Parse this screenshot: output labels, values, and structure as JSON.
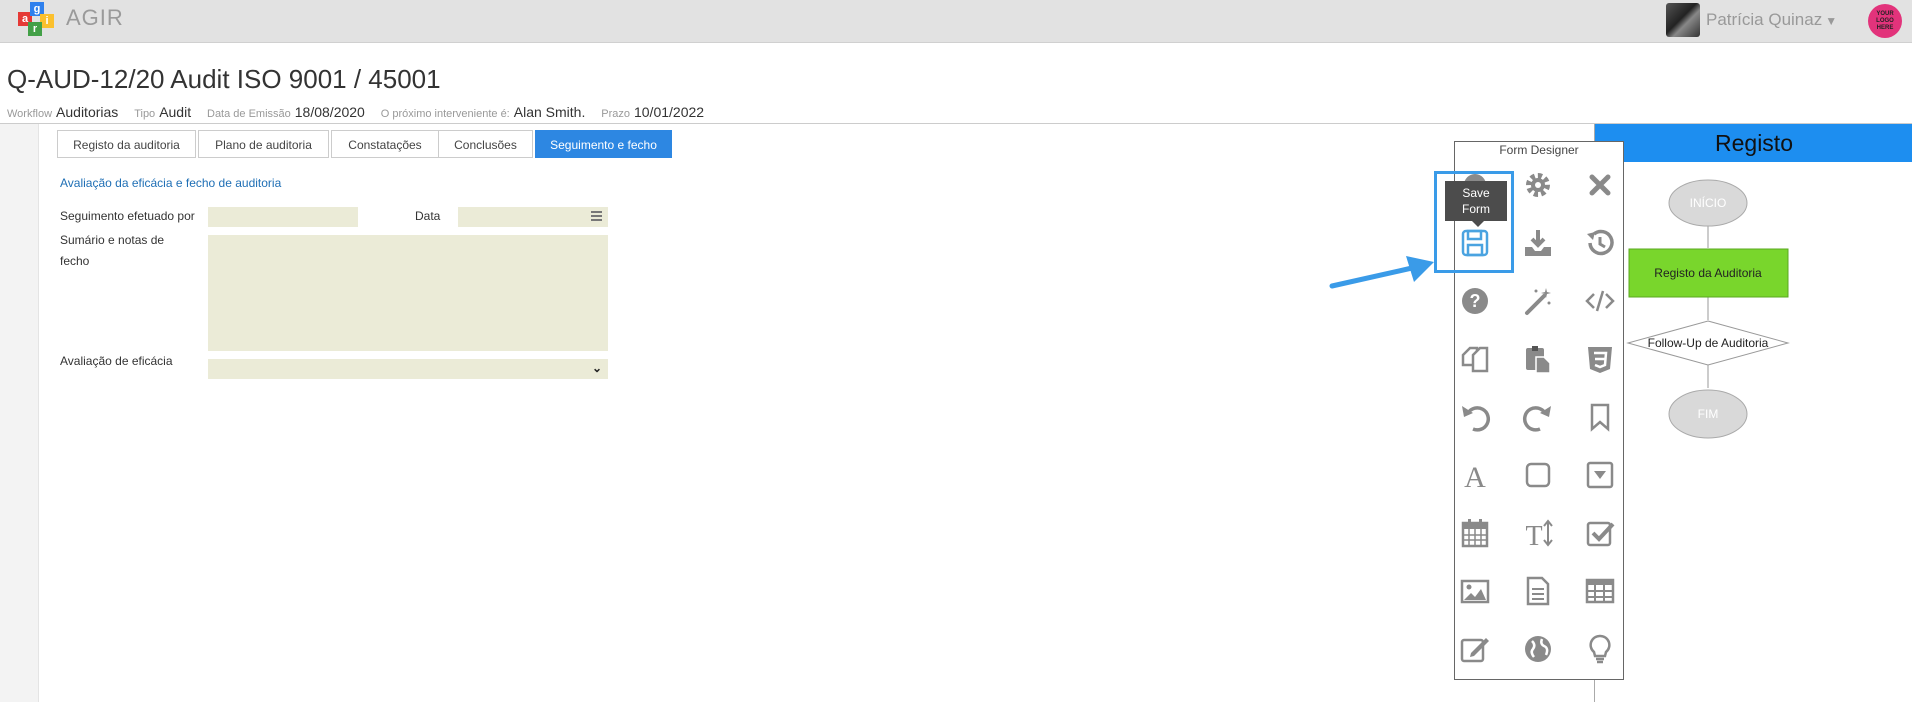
{
  "app": {
    "name": "AGIR",
    "logo_letters": [
      "a",
      "g",
      "i",
      "r"
    ]
  },
  "user": {
    "name": "Patrícia Quinaz",
    "company_logo_text": "YOUR LOGO HERE"
  },
  "header": {
    "title": "Q-AUD-12/20 Audit ISO 9001 / 45001",
    "meta": [
      {
        "label": "Workflow",
        "value": "Auditorias"
      },
      {
        "label": "Tipo",
        "value": "Audit"
      },
      {
        "label": "Data de Emissão",
        "value": "18/08/2020"
      },
      {
        "label": "O próximo interveniente é:",
        "value": "Alan Smith."
      },
      {
        "label": "Prazo",
        "value": "10/01/2022"
      }
    ]
  },
  "tabs": [
    {
      "label": "Registo da auditoria",
      "active": false
    },
    {
      "label": "Plano de auditoria",
      "active": false
    },
    {
      "label": "Constatações",
      "active": false
    },
    {
      "label": "Conclusões",
      "active": false
    },
    {
      "label": "Seguimento e fecho",
      "active": true
    }
  ],
  "form": {
    "section_title": "Avaliação da eficácia e fecho de auditoria",
    "seguimento_label": "Seguimento efetuado por",
    "seguimento_value": "",
    "data_label": "Data",
    "data_value": "",
    "sumario_label_line1": "Sumário e notas de",
    "sumario_label_line2": "fecho",
    "sumario_value": "",
    "avaliacao_label": "Avaliação de eficácia",
    "avaliacao_value": ""
  },
  "form_designer": {
    "title": "Form Designer",
    "tooltip_line1": "Save",
    "tooltip_line2": "Form",
    "tools": [
      "preview-icon",
      "settings-gear-icon",
      "close-icon",
      "save-icon",
      "download-tray-icon",
      "history-icon",
      "help-icon",
      "magic-wand-icon",
      "code-icon",
      "copy-icon",
      "paste-icon",
      "css3-icon",
      "undo-icon",
      "redo-icon",
      "bookmark-icon",
      "text-label-icon",
      "rectangle-icon",
      "dropdown-icon",
      "calendar-icon",
      "text-size-icon",
      "checkbox-icon",
      "image-icon",
      "document-icon",
      "table-icon",
      "edit-icon",
      "globe-icon",
      "lightbulb-icon"
    ]
  },
  "workflow": {
    "title": "Registo",
    "nodes": [
      {
        "label": "INÍCIO",
        "shape": "ellipse",
        "state": "done"
      },
      {
        "label": "Registo da Auditoria",
        "shape": "rect",
        "state": "current"
      },
      {
        "label": "Follow-Up de Auditoria",
        "shape": "diamond",
        "state": "pending"
      },
      {
        "label": "FIM",
        "shape": "ellipse",
        "state": "done"
      }
    ],
    "colors": {
      "header": "#1d8ef0",
      "current": "#79d62c",
      "done": "#d9d9d9"
    }
  },
  "colors": {
    "accent": "#2d87e2",
    "field_bg": "#ebebd7",
    "highlight": "#3a9be8"
  }
}
